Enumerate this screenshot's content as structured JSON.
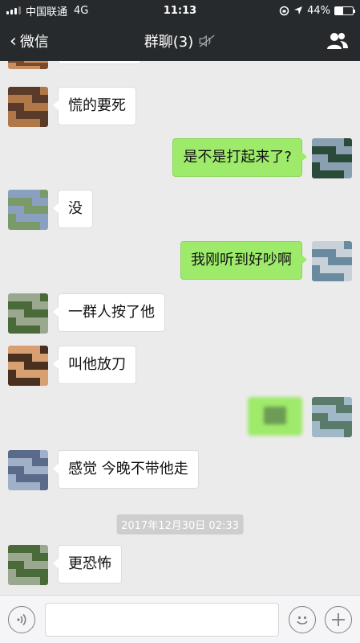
{
  "status_bar": {
    "carrier": "中国联通",
    "network": "4G",
    "time": "11:13",
    "battery": "44%",
    "battery_level": 0.44
  },
  "nav": {
    "back_label": "微信",
    "title": "群聊(3)"
  },
  "messages": [
    {
      "side": "left",
      "text": "慌的要死",
      "avatar": "avatar-orange"
    },
    {
      "side": "right",
      "text": "是不是打起来了?",
      "avatar": "avatar-self"
    },
    {
      "side": "left",
      "text": "没",
      "avatar": "avatar-blue"
    },
    {
      "side": "right",
      "text": "我刚听到好吵啊",
      "avatar": "avatar-self"
    },
    {
      "side": "left",
      "text": "一群人按了他",
      "avatar": "avatar-blue"
    },
    {
      "side": "left",
      "text": "叫他放刀",
      "avatar": "avatar-orange"
    },
    {
      "side": "right",
      "text": "",
      "avatar": "avatar-self",
      "blurred": true
    },
    {
      "side": "left",
      "text": "感觉 今晚不带他走",
      "avatar": "avatar-blue"
    },
    {
      "side": "left",
      "text": "更恐怖",
      "avatar": "avatar-blue"
    }
  ],
  "timestamp": "2017年12月30日 02:33",
  "colors": {
    "header_bg": "#262a2d",
    "chat_bg": "#ebebeb",
    "self_bubble": "#9eea6a",
    "other_bubble": "#ffffff"
  },
  "icons": {
    "back": "chevron-left-icon",
    "mute": "mute-icon",
    "contacts": "contacts-icon",
    "voice": "voice-icon",
    "emoji": "emoji-icon",
    "plus": "plus-icon"
  }
}
